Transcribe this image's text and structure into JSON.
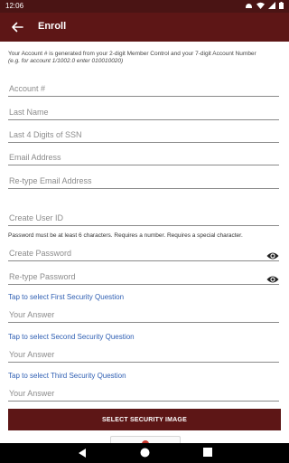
{
  "status_bar": {
    "time": "12:06",
    "icons": [
      "android-notification-icon",
      "wifi-icon",
      "signal-icon",
      "battery-icon"
    ]
  },
  "app_bar": {
    "title": "Enroll",
    "back_icon": "arrow-back-icon"
  },
  "info": {
    "text": "Your Account # is generated from your 2-digit Member Control and your 7-digit Account Number",
    "example": "(e.g. for account 1/1002.0 enter 010010020)"
  },
  "fields": {
    "account": "Account #",
    "last_name": "Last Name",
    "ssn": "Last 4 Digits of SSN",
    "email": "Email Address",
    "retype_email": "Re-type Email Address",
    "user_id": "Create User ID",
    "password": "Create Password",
    "retype_password": "Re-type Password",
    "answer1": "Your Answer",
    "answer2": "Your Answer",
    "answer3": "Your Answer"
  },
  "password_note": "Password must be at least 6 characters. Requires a number. Requires a special character.",
  "security_links": {
    "first": "Tap to select First Security Question",
    "second": "Tap to select Second Security Question",
    "third": "Tap to select Third Security Question"
  },
  "select_image_button": "SELECT SECURITY IMAGE",
  "icons": {
    "eye": "visibility-eye-icon"
  },
  "colors": {
    "primary": "#5d1616",
    "status_bar": "#4a1414",
    "link": "#2f5fb3"
  }
}
